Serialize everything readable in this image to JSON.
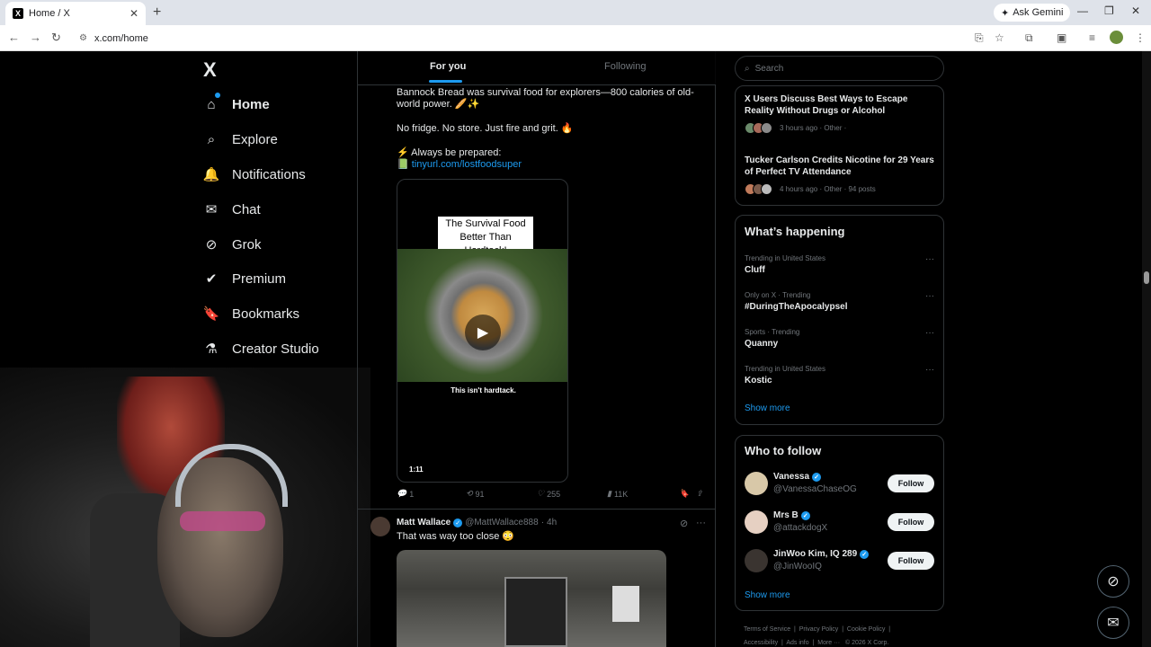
{
  "browser": {
    "tab_title": "Home / X",
    "tab_favicon": "X",
    "new_tab": "+",
    "ask_gemini": "Ask Gemini",
    "url": "x.com/home"
  },
  "nav": {
    "logo": "X",
    "items": [
      {
        "label": "Home",
        "icon": "home-icon",
        "glyph": "⌂"
      },
      {
        "label": "Explore",
        "icon": "search-icon",
        "glyph": "⌕"
      },
      {
        "label": "Notifications",
        "icon": "bell-icon",
        "glyph": "🔔"
      },
      {
        "label": "Chat",
        "icon": "mail-icon",
        "glyph": "✉"
      },
      {
        "label": "Grok",
        "icon": "grok-icon",
        "glyph": "⊘"
      },
      {
        "label": "Premium",
        "icon": "premium-icon",
        "glyph": "✔"
      },
      {
        "label": "Bookmarks",
        "icon": "bookmark-icon",
        "glyph": "🔖"
      },
      {
        "label": "Creator Studio",
        "icon": "flask-icon",
        "glyph": "⚗"
      }
    ]
  },
  "feed": {
    "tabs": [
      "For you",
      "Following"
    ],
    "post1": {
      "line1": "Bannock Bread was survival food for explorers—800 calories of old-world power. 🥖✨",
      "line2": "No fridge. No store. Just fire and grit. 🔥",
      "line3": "⚡ Always be prepared:",
      "link_prefix": "📗 ",
      "link": "tinyurl.com/lostfoodsuper",
      "media_caption": "The Survival Food Better Than Hardtack!",
      "media_sub": "This isn't hardtack.",
      "duration": "1:11",
      "replies": "1",
      "reposts": "91",
      "likes": "255",
      "views": "11K"
    },
    "post2": {
      "name": "Matt Wallace",
      "handle": "@MattWallace888",
      "sep": "·",
      "time": "4h",
      "text": "That was way too close 😳"
    }
  },
  "sidebar": {
    "search_placeholder": "Search",
    "news": [
      {
        "title": "X Users Discuss Best Ways to Escape Reality Without Drugs or Alcohol",
        "meta": "3 hours ago · Other ·"
      },
      {
        "title": "Tucker Carlson Credits Nicotine for 29 Years of Perfect TV Attendance",
        "meta": "4 hours ago · Other · 94 posts"
      }
    ],
    "whats_happening": {
      "title": "What’s happening",
      "trends": [
        {
          "context": "Trending in United States",
          "name": "Cluff"
        },
        {
          "context": "Only on X · Trending",
          "name": "#DuringTheApocalypsel"
        },
        {
          "context": "Sports · Trending",
          "name": "Quanny"
        },
        {
          "context": "Trending in United States",
          "name": "Kostic"
        }
      ],
      "show_more": "Show more"
    },
    "who_to_follow": {
      "title": "Who to follow",
      "users": [
        {
          "name": "Vanessa",
          "handle": "@VanessaChaseOG",
          "button": "Follow",
          "avatar_color": "#d8c8a8"
        },
        {
          "name": "Mrs B",
          "handle": "@attackdogX",
          "button": "Follow",
          "avatar_color": "#e6d0c2"
        },
        {
          "name": "JinWoo Kim, IQ 289",
          "handle": "@JinWooIQ",
          "button": "Follow",
          "avatar_color": "#3a3430"
        }
      ],
      "show_more": "Show more"
    },
    "footer": {
      "line1": [
        "Terms of Service",
        "Privacy Policy",
        "Cookie Policy"
      ],
      "line2": [
        "Accessibility",
        "Ads info",
        "More ···",
        "© 2026 X Corp."
      ]
    }
  },
  "colors": {
    "accent": "#1d9bf0",
    "background": "#000000",
    "border": "#2f3336"
  }
}
